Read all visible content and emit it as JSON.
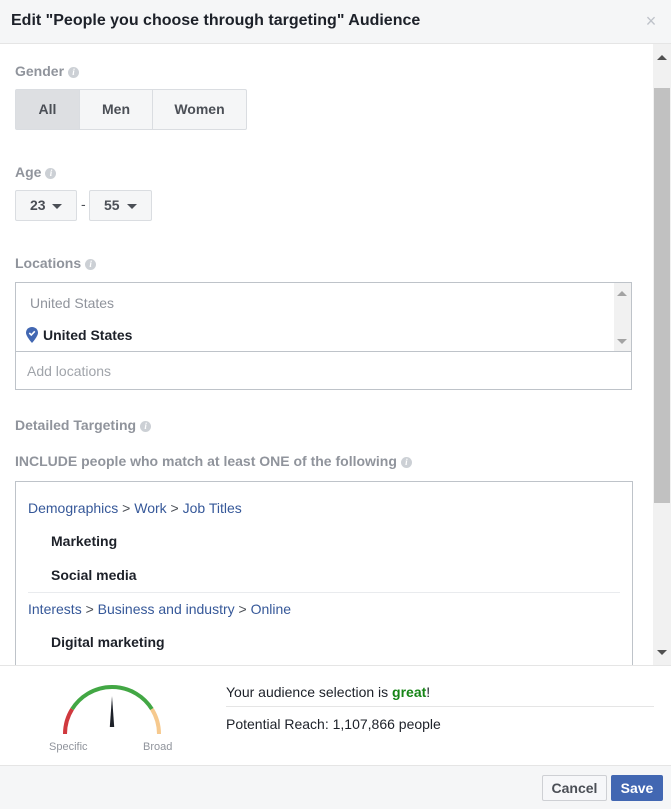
{
  "dialog": {
    "title": "Edit \"People you choose through targeting\" Audience",
    "close_icon": "×"
  },
  "gender": {
    "label": "Gender",
    "options": [
      "All",
      "Men",
      "Women"
    ],
    "selected": "All"
  },
  "age": {
    "label": "Age",
    "min": "23",
    "max": "55",
    "separator": "-"
  },
  "locations": {
    "label": "Locations",
    "group_header": "United States",
    "items": [
      "United States"
    ],
    "add_placeholder": "Add locations"
  },
  "detailed_targeting": {
    "label": "Detailed Targeting",
    "include_label": "INCLUDE people who match at least ONE of the following",
    "groups": [
      {
        "path": [
          "Demographics",
          "Work",
          "Job Titles"
        ],
        "items": [
          "Marketing",
          "Social media"
        ]
      },
      {
        "path": [
          "Interests",
          "Business and industry",
          "Online"
        ],
        "items": [
          "Digital marketing"
        ]
      }
    ],
    "path_separator": ">"
  },
  "audience_summary": {
    "selection_prefix": "Your audience selection is ",
    "selection_quality": "great",
    "selection_suffix": "!",
    "potential_reach": "Potential Reach: 1,107,866 people",
    "gauge": {
      "left_label": "Specific",
      "right_label": "Broad",
      "needle_position": 0.5,
      "colors": {
        "specific": "#d0393e",
        "good": "#42a744",
        "broad": "#f6c98e",
        "needle": "#1d2129"
      }
    }
  },
  "footer": {
    "cancel_label": "Cancel",
    "save_label": "Save"
  },
  "colors": {
    "brand_blue": "#4267b2",
    "link_blue": "#365899",
    "great_green": "#168416"
  }
}
